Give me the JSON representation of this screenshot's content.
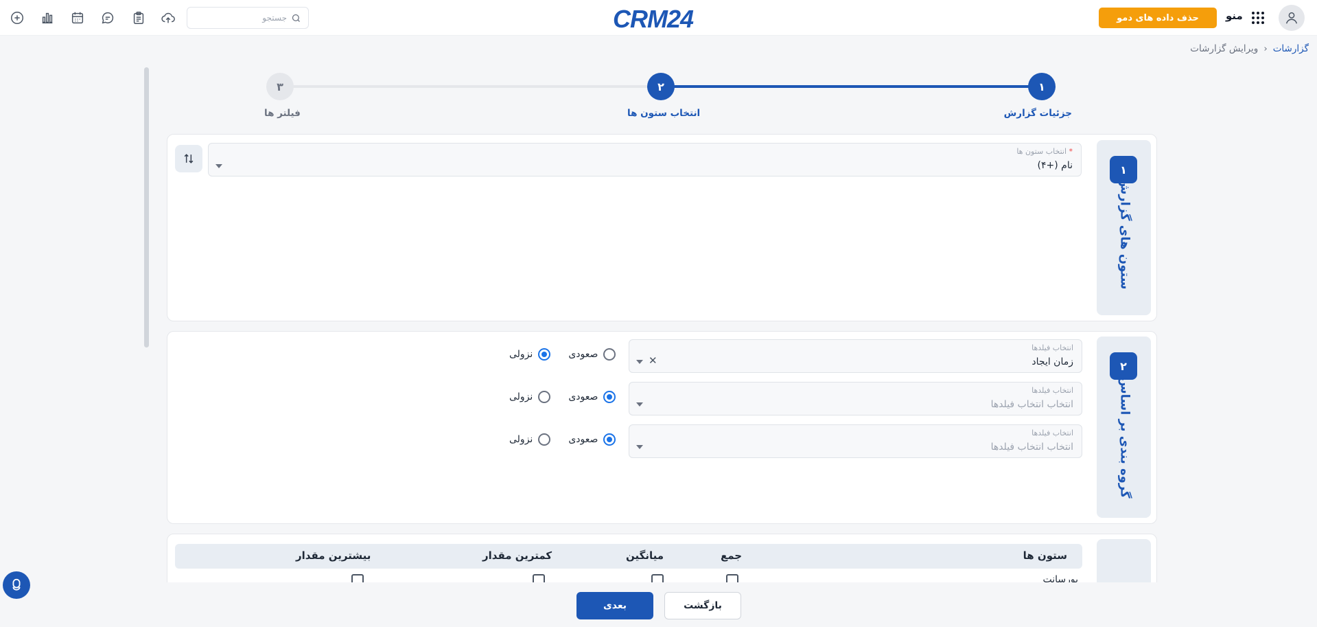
{
  "header": {
    "logo_text": "CRM24",
    "search_placeholder": "جستجو",
    "demo_button": "حذف داده های دمو",
    "menu_label": "منو",
    "icons": [
      "plus-circle-icon",
      "bar-chart-icon",
      "calendar-icon",
      "chat-icon",
      "clipboard-icon",
      "cloud-upload-icon"
    ]
  },
  "breadcrumb": {
    "root": "گزارشات",
    "current": "ویرایش گزارشات"
  },
  "stepper": {
    "steps": [
      {
        "number": "۱",
        "label": "جزئیات گزارش",
        "state": "active"
      },
      {
        "number": "۲",
        "label": "انتخاب ستون ها",
        "state": "active"
      },
      {
        "number": "۳",
        "label": "فیلتر ها",
        "state": "pending"
      }
    ]
  },
  "section_columns": {
    "number": "۱",
    "title": "ستون های گزارش",
    "field_label": "انتخاب ستون ها",
    "required_mark": "*",
    "field_value": "نام (+۴)"
  },
  "section_grouping": {
    "number": "۲",
    "title": "گروه بندی بر اساس",
    "rows": [
      {
        "label": "انتخاب فیلدها",
        "value": "زمان ایجاد",
        "is_placeholder": false,
        "asc": "صعودی",
        "desc": "نزولی",
        "selected": "desc"
      },
      {
        "label": "انتخاب فیلدها",
        "value": "انتخاب انتخاب فیلدها",
        "is_placeholder": true,
        "asc": "صعودی",
        "desc": "نزولی",
        "selected": "asc"
      },
      {
        "label": "انتخاب فیلدها",
        "value": "انتخاب انتخاب فیلدها",
        "is_placeholder": true,
        "asc": "صعودی",
        "desc": "نزولی",
        "selected": "asc"
      }
    ]
  },
  "section_summary": {
    "headers": {
      "columns": "ستون ها",
      "sum": "جمع",
      "avg": "میانگین",
      "min": "کمترین مقدار",
      "max": "بیشترین مقدار"
    },
    "first_row_label": "پورسانت"
  },
  "footer": {
    "next": "بعدی",
    "back": "بازگشت"
  },
  "colors": {
    "primary": "#1d57b5",
    "accent": "#f59e0b",
    "radio": "#1a73e8"
  }
}
